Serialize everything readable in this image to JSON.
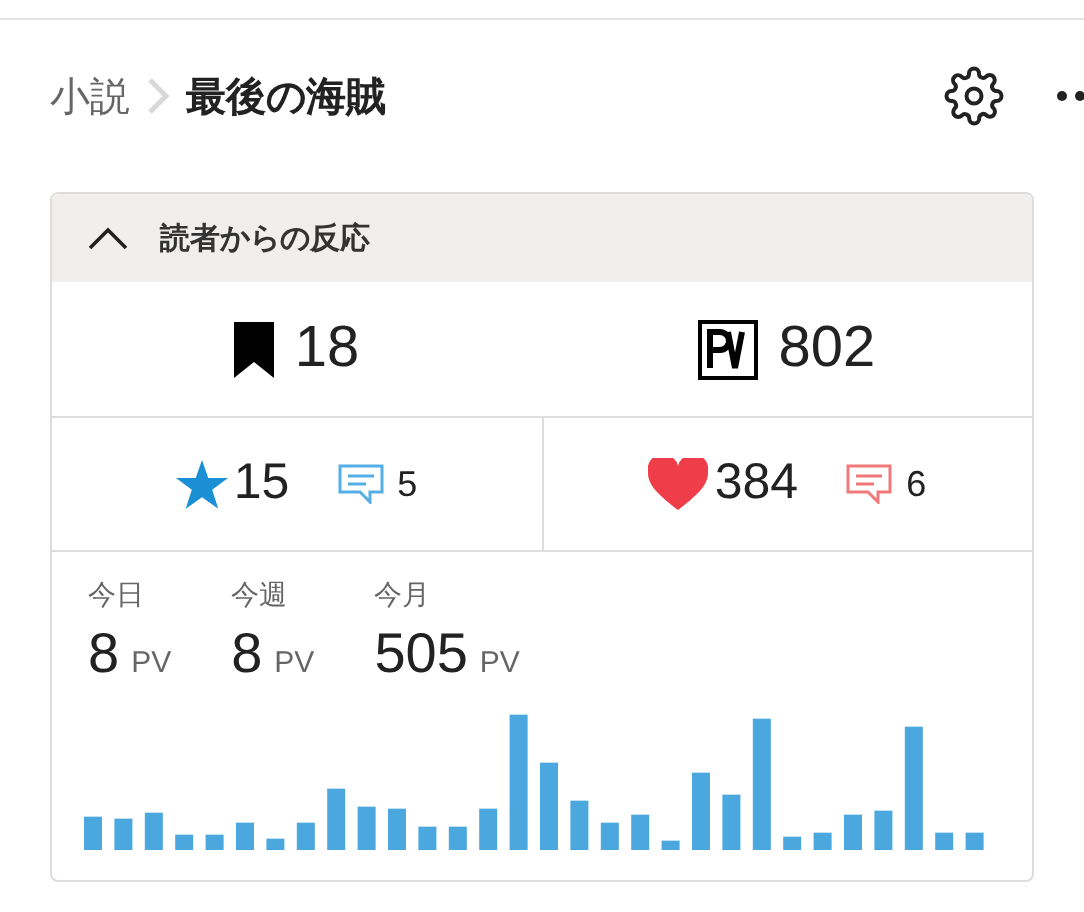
{
  "breadcrumb": {
    "parent": "小説",
    "current": "最後の海賊"
  },
  "panel": {
    "title": "読者からの反応",
    "expanded": true,
    "totals": [
      {
        "kind": "bookmark",
        "value": "18"
      },
      {
        "kind": "pv",
        "value": "802"
      }
    ],
    "reactions": [
      {
        "kind": "star",
        "value": "15",
        "comments": "5"
      },
      {
        "kind": "heart",
        "value": "384",
        "comments": "6"
      }
    ],
    "periods": [
      {
        "label": "今日",
        "value": "8",
        "unit": "PV"
      },
      {
        "label": "今週",
        "value": "8",
        "unit": "PV"
      },
      {
        "label": "今月",
        "value": "505",
        "unit": "PV"
      }
    ]
  }
}
